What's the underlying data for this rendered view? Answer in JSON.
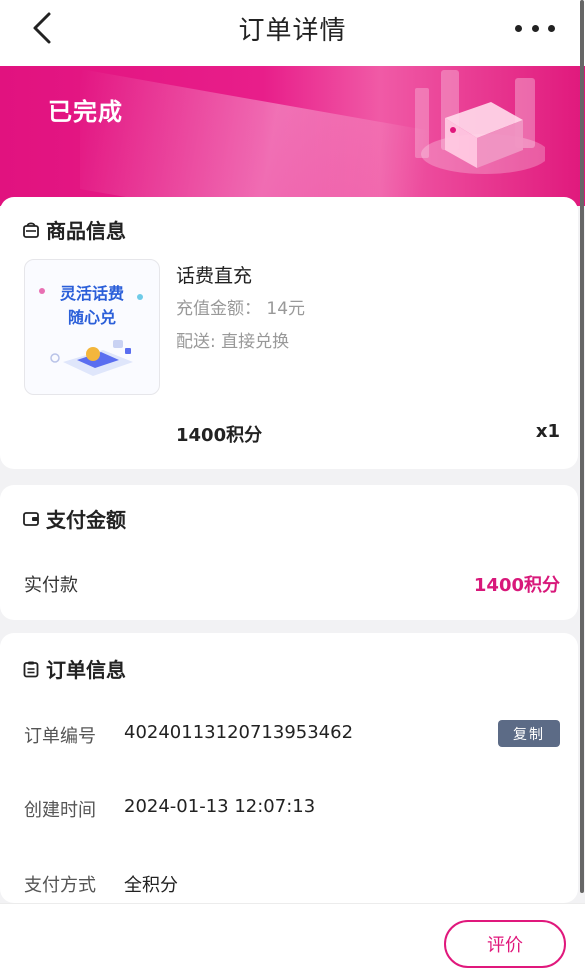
{
  "header": {
    "title": "订单详情"
  },
  "banner": {
    "status": "已完成"
  },
  "product_section": {
    "title": "商品信息",
    "thumbnail_text_line1": "灵活话费",
    "thumbnail_text_line2": "随心兑",
    "name": "话费直充",
    "amount_label": "充值金额：",
    "amount_value": "14元",
    "delivery": "配送: 直接兑换",
    "price": "1400积分",
    "quantity": "x1"
  },
  "payment_section": {
    "title": "支付金额",
    "paid_label": "实付款",
    "paid_value": "1400积分"
  },
  "order_section": {
    "title": "订单信息",
    "rows": [
      {
        "label": "订单编号",
        "value": "40240113120713953462"
      },
      {
        "label": "创建时间",
        "value": "2024-01-13 12:07:13"
      },
      {
        "label": "支付方式",
        "value": "全积分"
      }
    ],
    "copy_label": "复制"
  },
  "bottom_bar": {
    "review_label": "评价"
  },
  "colors": {
    "accent": "#e0187c",
    "copy_button": "#5c6b86"
  }
}
